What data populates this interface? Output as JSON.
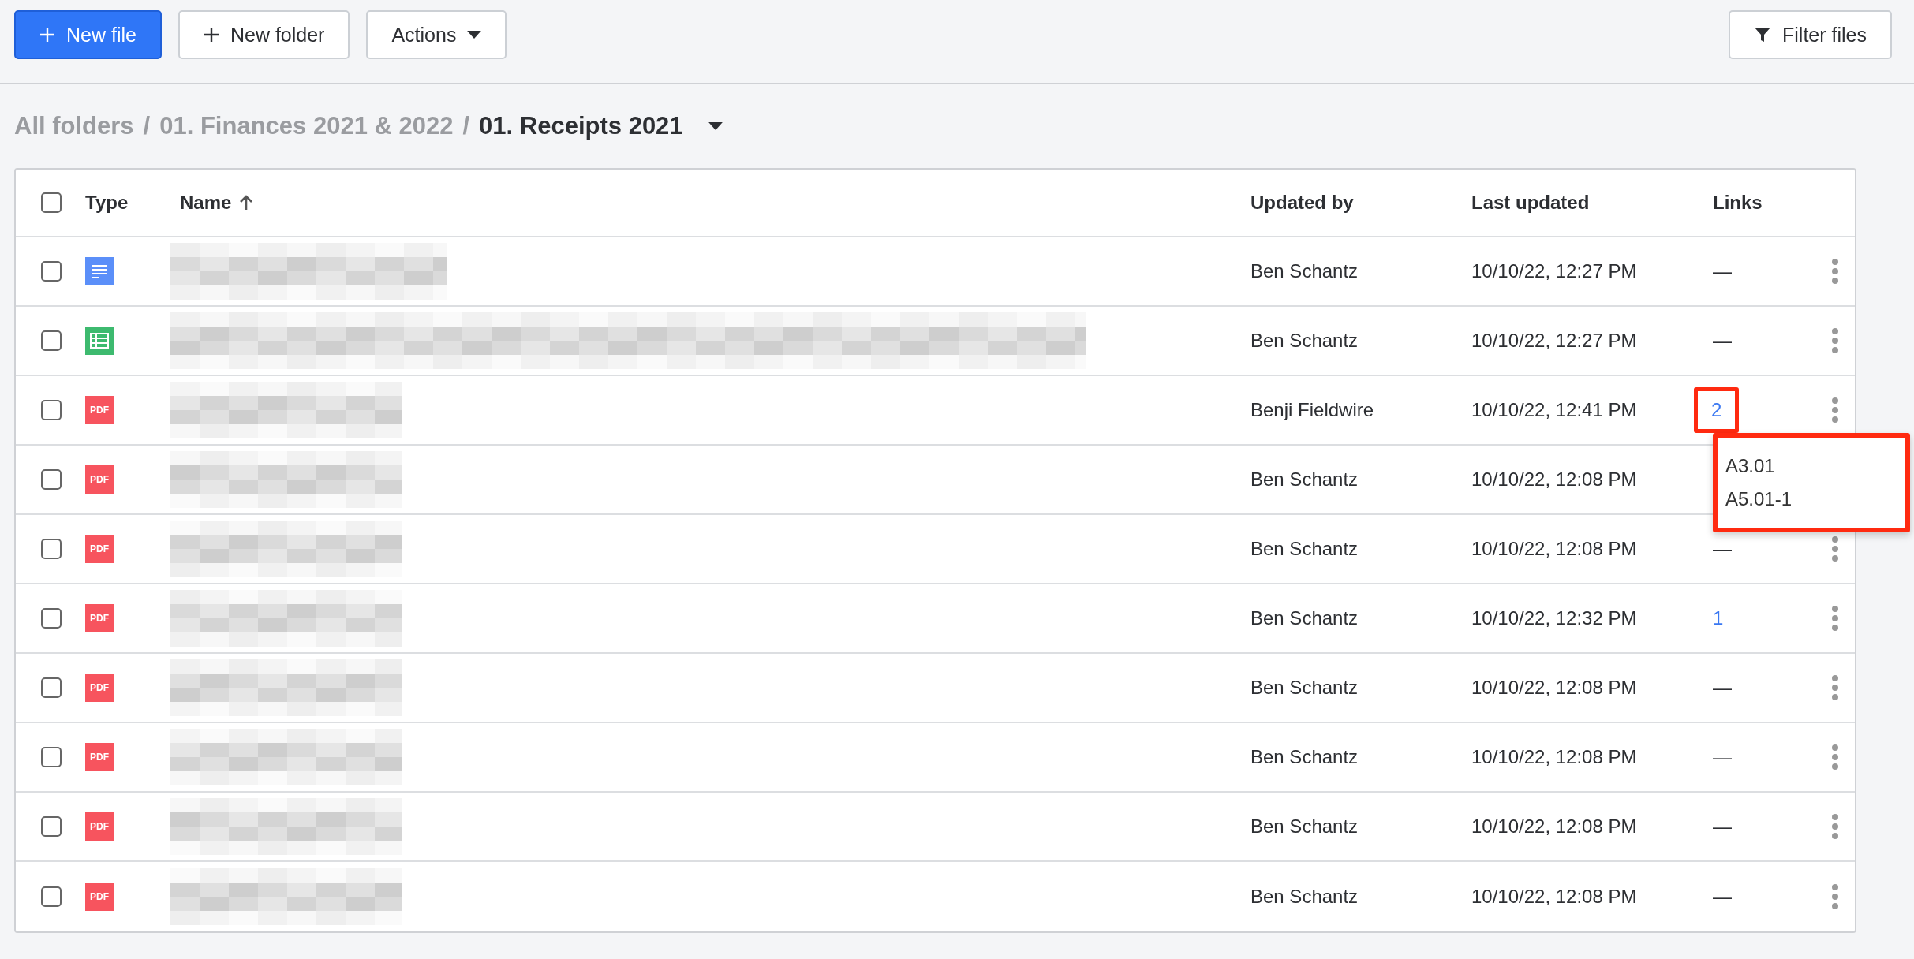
{
  "toolbar": {
    "buttons": [
      {
        "label": "New file",
        "kind": "primary"
      },
      {
        "label": "New folder",
        "kind": "secondary"
      },
      {
        "label": "Actions",
        "kind": "dropdown"
      }
    ],
    "filter": {
      "label": "Filter files"
    }
  },
  "breadcrumb": {
    "items": [
      {
        "label": "All folders",
        "current": false
      },
      {
        "label": "01. Finances 2021 & 2022",
        "current": false
      },
      {
        "label": "01. Receipts 2021",
        "current": true
      }
    ],
    "separator": "/"
  },
  "table": {
    "select_all": {
      "checked": false
    },
    "columns": [
      {
        "label": "Type",
        "sorted": false
      },
      {
        "label": "Name",
        "sorted": true
      },
      {
        "label": "Updated by",
        "sorted": false
      },
      {
        "label": "Last updated",
        "sorted": false
      },
      {
        "label": "Links",
        "sorted": false
      }
    ],
    "rows": [
      {
        "checked": false,
        "type": {
          "kind": "doc"
        },
        "updated_by": "Ben Schantz",
        "last_updated": "10/10/22, 12:27 PM",
        "links": {
          "text": "—",
          "kind": "none"
        }
      },
      {
        "checked": false,
        "type": {
          "kind": "sheet"
        },
        "updated_by": "Ben Schantz",
        "last_updated": "10/10/22, 12:27 PM",
        "links": {
          "text": "—",
          "kind": "none"
        }
      },
      {
        "checked": false,
        "type": {
          "kind": "pdf",
          "label": "PDF"
        },
        "updated_by": "Benji Fieldwire",
        "last_updated": "10/10/22, 12:41 PM",
        "links": {
          "text": "2",
          "kind": "link",
          "highlighted": true,
          "popup": [
            "A3.01",
            "A5.01-1"
          ]
        }
      },
      {
        "checked": false,
        "type": {
          "kind": "pdf",
          "label": "PDF"
        },
        "updated_by": "Ben Schantz",
        "last_updated": "10/10/22, 12:08 PM"
      },
      {
        "checked": false,
        "type": {
          "kind": "pdf",
          "label": "PDF"
        },
        "updated_by": "Ben Schantz",
        "last_updated": "10/10/22, 12:08 PM",
        "links": {
          "text": "—",
          "kind": "none"
        }
      },
      {
        "checked": false,
        "type": {
          "kind": "pdf",
          "label": "PDF"
        },
        "updated_by": "Ben Schantz",
        "last_updated": "10/10/22, 12:32 PM",
        "links": {
          "text": "1",
          "kind": "link",
          "highlighted": false
        }
      },
      {
        "checked": false,
        "type": {
          "kind": "pdf",
          "label": "PDF"
        },
        "updated_by": "Ben Schantz",
        "last_updated": "10/10/22, 12:08 PM",
        "links": {
          "text": "—",
          "kind": "none"
        }
      },
      {
        "checked": false,
        "type": {
          "kind": "pdf",
          "label": "PDF"
        },
        "updated_by": "Ben Schantz",
        "last_updated": "10/10/22, 12:08 PM",
        "links": {
          "text": "—",
          "kind": "none"
        }
      },
      {
        "checked": false,
        "type": {
          "kind": "pdf",
          "label": "PDF"
        },
        "updated_by": "Ben Schantz",
        "last_updated": "10/10/22, 12:08 PM",
        "links": {
          "text": "—",
          "kind": "none"
        }
      },
      {
        "checked": false,
        "type": {
          "kind": "pdf",
          "label": "PDF"
        },
        "updated_by": "Ben Schantz",
        "last_updated": "10/10/22, 12:08 PM",
        "links": {
          "text": "—",
          "kind": "none"
        }
      }
    ]
  }
}
